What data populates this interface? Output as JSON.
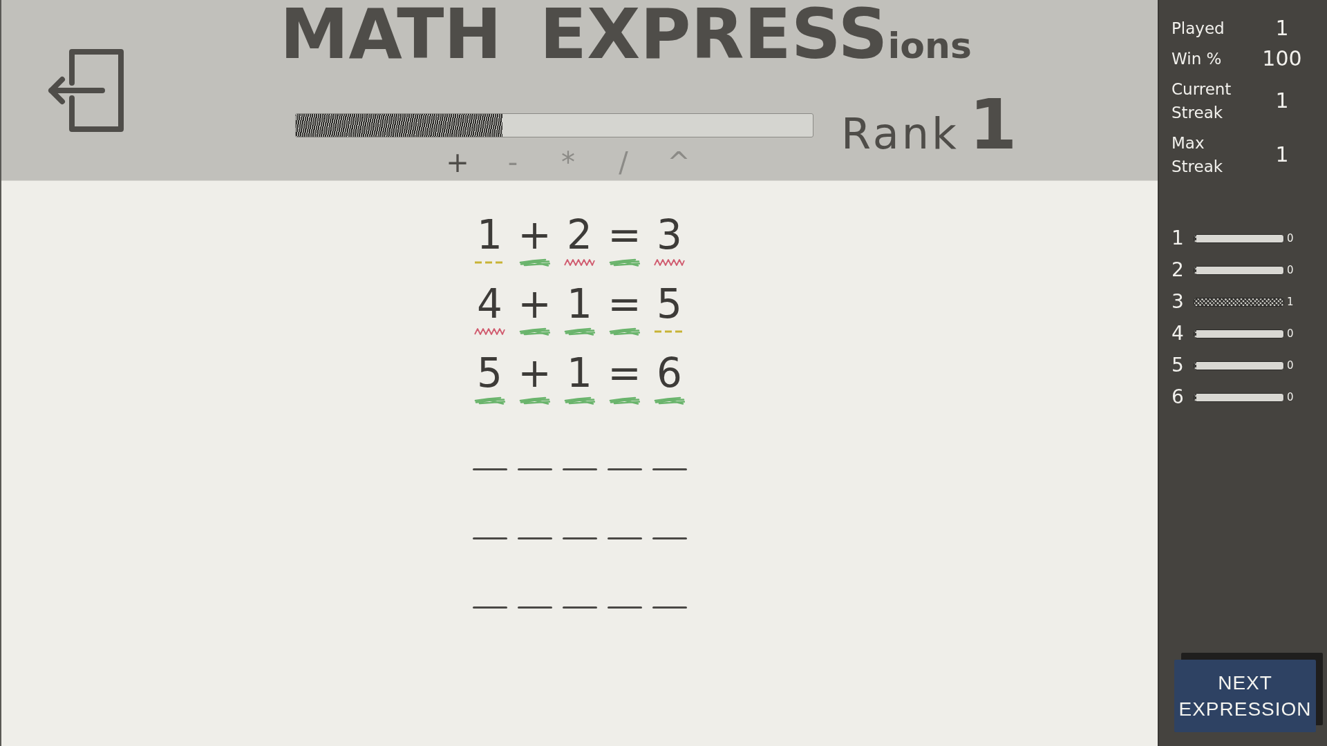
{
  "header": {
    "title": {
      "large": "MATH EXPRESS",
      "small": "ions"
    },
    "progress": {
      "level": 0.4
    },
    "rank": {
      "label": "Rank",
      "value": "1"
    },
    "operators": [
      {
        "symbol": "+",
        "disabled": false
      },
      {
        "symbol": "-",
        "disabled": true
      },
      {
        "symbol": "*",
        "disabled": true
      },
      {
        "symbol": "/",
        "disabled": true
      },
      {
        "symbol": "^",
        "disabled": true
      }
    ]
  },
  "rows": [
    {
      "cells": [
        {
          "value": "1",
          "kind": "misplaced"
        },
        {
          "value": "+",
          "kind": "correct"
        },
        {
          "value": "2",
          "kind": "wrong"
        },
        {
          "value": "=",
          "kind": "correct"
        },
        {
          "value": "3",
          "kind": "wrong"
        }
      ]
    },
    {
      "cells": [
        {
          "value": "4",
          "kind": "wrong"
        },
        {
          "value": "+",
          "kind": "correct"
        },
        {
          "value": "1",
          "kind": "correct"
        },
        {
          "value": "=",
          "kind": "correct"
        },
        {
          "value": "5",
          "kind": "misplaced"
        }
      ]
    },
    {
      "cells": [
        {
          "value": "5",
          "kind": "correct"
        },
        {
          "value": "+",
          "kind": "correct"
        },
        {
          "value": "1",
          "kind": "correct"
        },
        {
          "value": "=",
          "kind": "correct"
        },
        {
          "value": "6",
          "kind": "correct"
        }
      ]
    },
    {
      "cells": [
        {
          "kind": "empty"
        },
        {
          "kind": "empty"
        },
        {
          "kind": "empty"
        },
        {
          "kind": "empty"
        },
        {
          "kind": "empty"
        }
      ]
    },
    {
      "cells": [
        {
          "kind": "empty"
        },
        {
          "kind": "empty"
        },
        {
          "kind": "empty"
        },
        {
          "kind": "empty"
        },
        {
          "kind": "empty"
        }
      ]
    },
    {
      "cells": [
        {
          "kind": "empty"
        },
        {
          "kind": "empty"
        },
        {
          "kind": "empty"
        },
        {
          "kind": "empty"
        },
        {
          "kind": "empty"
        }
      ]
    }
  ],
  "sidebar": {
    "stats": [
      {
        "label": "Played",
        "value": "1"
      },
      {
        "label": "Win %",
        "value": "100"
      },
      {
        "label": "Current Streak",
        "value": "1"
      },
      {
        "label": "Max Streak",
        "value": "1"
      }
    ],
    "distribution": [
      {
        "label": "1",
        "count": "0",
        "level": 0
      },
      {
        "label": "2",
        "count": "0",
        "level": 0
      },
      {
        "label": "3",
        "count": "1",
        "level": 1
      },
      {
        "label": "4",
        "count": "0",
        "level": 0
      },
      {
        "label": "5",
        "count": "0",
        "level": 0
      },
      {
        "label": "6",
        "count": "0",
        "level": 0
      }
    ],
    "button": "NEXT EXPRESSION"
  }
}
